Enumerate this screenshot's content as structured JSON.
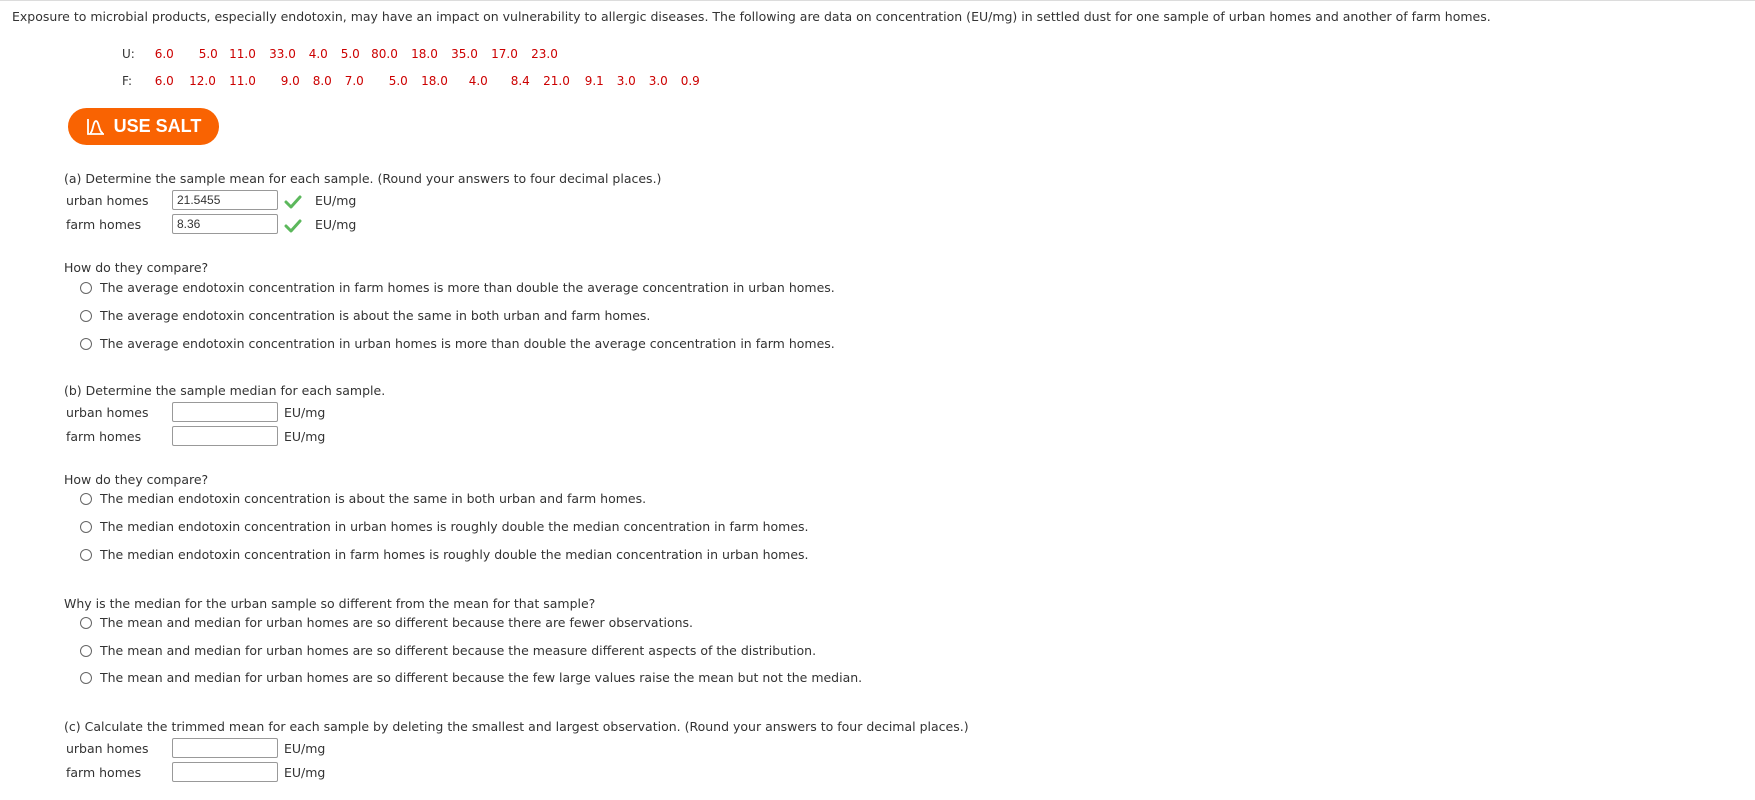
{
  "intro": "Exposure to microbial products, especially endotoxin, may have an impact on vulnerability to allergic diseases. The following are data on concentration (EU/mg) in settled dust for one sample of urban homes and another of farm homes.",
  "data": {
    "urban": {
      "label": "U:",
      "values": [
        "6.0",
        "5.0",
        "11.0",
        "33.0",
        "4.0",
        "5.0",
        "80.0",
        "18.0",
        "35.0",
        "17.0",
        "23.0"
      ]
    },
    "farm": {
      "label": "F:",
      "values": [
        "6.0",
        "12.0",
        "11.0",
        "9.0",
        "8.0",
        "7.0",
        "5.0",
        "18.0",
        "4.0",
        "8.4",
        "21.0",
        "9.1",
        "3.0",
        "3.0",
        "0.9"
      ]
    }
  },
  "salt_button": {
    "label": "USE SALT",
    "icon": "distribution-curve-icon",
    "color": "#f96302"
  },
  "part_a": {
    "prompt": "(a) Determine the sample mean for each sample. (Round your answers to four decimal places.)",
    "rows": [
      {
        "label": "urban homes",
        "value": "21.5455",
        "unit": "EU/mg",
        "status": "correct"
      },
      {
        "label": "farm homes",
        "value": "8.36",
        "unit": "EU/mg",
        "status": "correct"
      }
    ],
    "compare_prompt": "How do they compare?",
    "options": [
      "The average endotoxin concentration in farm homes is more than double the average concentration in urban homes.",
      "The average endotoxin concentration is about the same in both urban and farm homes.",
      "The average endotoxin concentration in urban homes is more than double the average concentration in farm homes."
    ]
  },
  "part_b": {
    "prompt": "(b) Determine the sample median for each sample.",
    "rows": [
      {
        "label": "urban homes",
        "value": "",
        "unit": "EU/mg"
      },
      {
        "label": "farm homes",
        "value": "",
        "unit": "EU/mg"
      }
    ],
    "compare_prompt": "How do they compare?",
    "options": [
      "The median endotoxin concentration is about the same in both urban and farm homes.",
      "The median endotoxin concentration in urban homes is roughly double the median concentration in farm homes.",
      "The median endotoxin concentration in farm homes is roughly double the median concentration in urban homes."
    ],
    "why_prompt": "Why is the median for the urban sample so different from the mean for that sample?",
    "why_options": [
      "The mean and median for urban homes are so different because there are fewer observations.",
      "The mean and median for urban homes are so different because the measure different aspects of the distribution.",
      "The mean and median for urban homes are so different because the few large values raise the mean but not the median."
    ]
  },
  "part_c": {
    "prompt": "(c) Calculate the trimmed mean for each sample by deleting the smallest and largest observation. (Round your answers to four decimal places.)",
    "rows": [
      {
        "label": "urban homes",
        "value": "",
        "unit": "EU/mg"
      },
      {
        "label": "farm homes",
        "value": "",
        "unit": "EU/mg"
      }
    ]
  }
}
